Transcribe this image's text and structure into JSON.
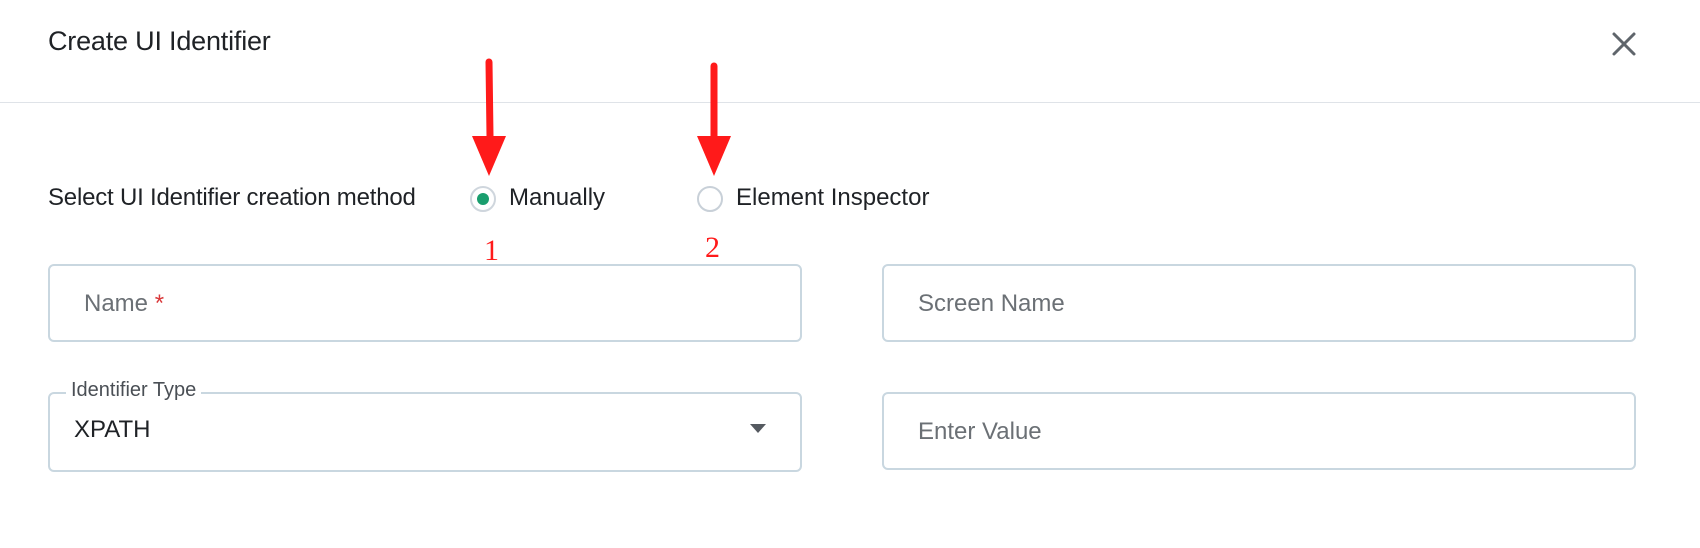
{
  "dialog": {
    "title": "Create UI Identifier",
    "close_icon": "close-icon"
  },
  "method": {
    "label": "Select UI Identifier creation method",
    "options": [
      {
        "label": "Manually",
        "selected": true
      },
      {
        "label": "Element Inspector",
        "selected": false
      }
    ]
  },
  "form": {
    "name_placeholder": "Name",
    "name_required_mark": "*",
    "screen_name_placeholder": "Screen Name",
    "identifier_type_label": "Identifier Type",
    "identifier_type_value": "XPATH",
    "value_placeholder": "Enter Value"
  },
  "annotations": {
    "marker_1": "1",
    "marker_2": "2",
    "color": "#ff1a1a"
  },
  "colors": {
    "accent": "#1a9e6e",
    "field_border": "#c9d7e0",
    "required": "#d9383a"
  }
}
